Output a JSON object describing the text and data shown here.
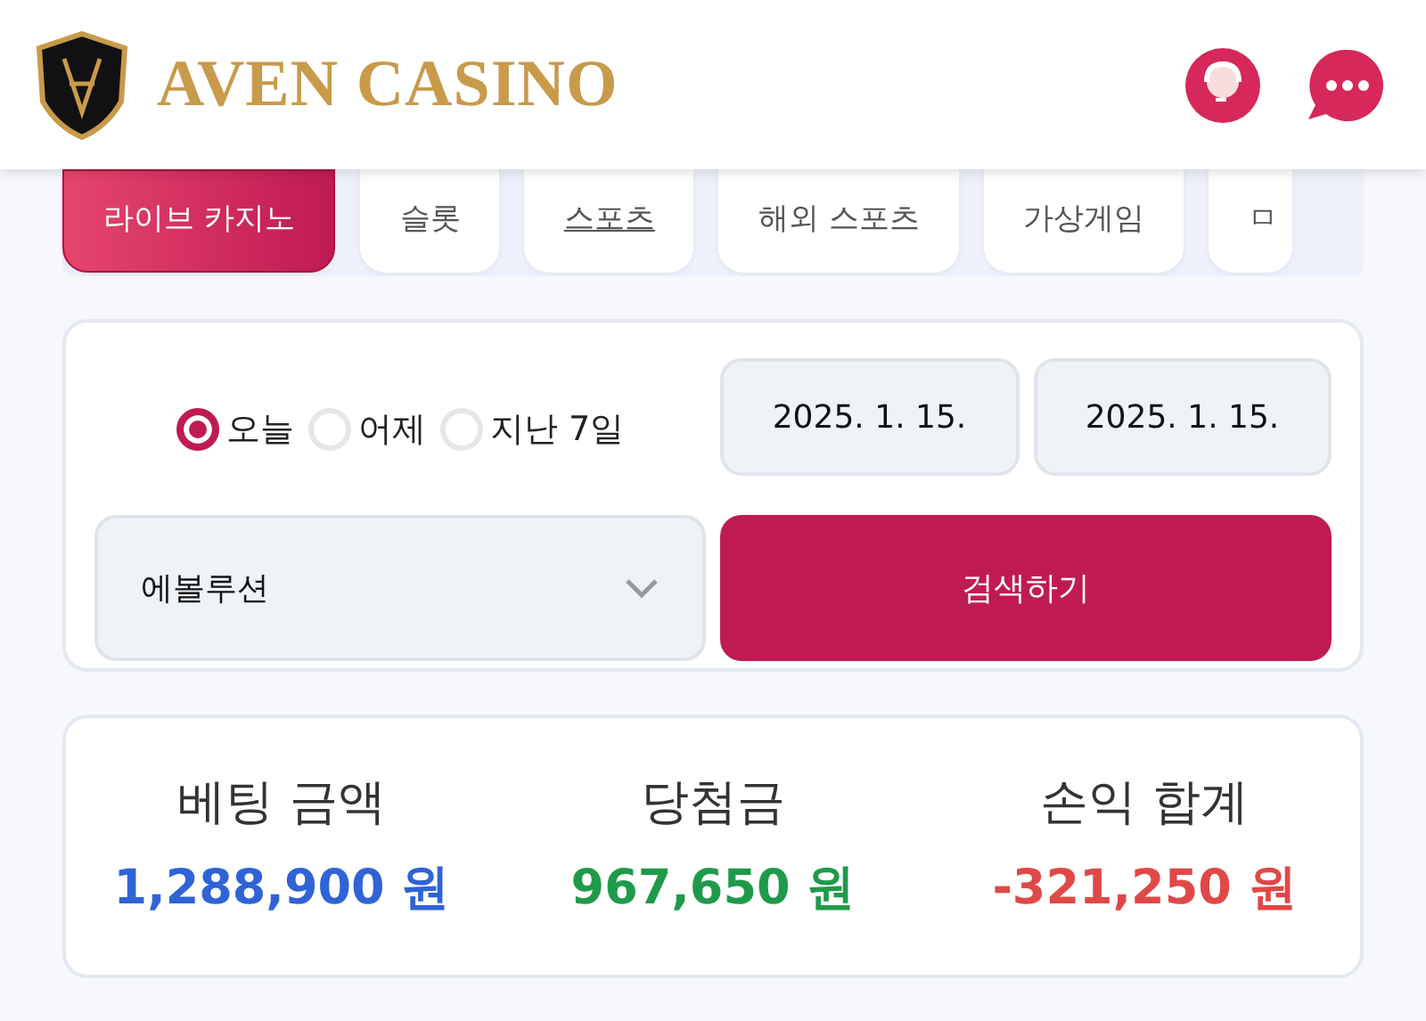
{
  "header": {
    "logo_text": "AVEN CASINO"
  },
  "tabs": [
    {
      "label": "라이브 카지노",
      "selected": true,
      "underlined": false
    },
    {
      "label": "슬롯",
      "selected": false,
      "underlined": false
    },
    {
      "label": "스포츠",
      "selected": false,
      "underlined": true
    },
    {
      "label": "해외 스포츠",
      "selected": false,
      "underlined": false
    },
    {
      "label": "가상게임",
      "selected": false,
      "underlined": false
    },
    {
      "label": "ㅁ",
      "selected": false,
      "underlined": false
    }
  ],
  "filter": {
    "periods": [
      {
        "label": "오늘",
        "selected": true
      },
      {
        "label": "어제",
        "selected": false
      },
      {
        "label": "지난 7일",
        "selected": false
      }
    ],
    "date_from": "2025. 1. 15.",
    "date_to": "2025. 1. 15.",
    "provider": "에볼루션",
    "search_button": "검색하기"
  },
  "summary": [
    {
      "label": "베팅 금액",
      "value": "1,288,900 원",
      "color": "#2f63d6"
    },
    {
      "label": "당첨금",
      "value": "967,650 원",
      "color": "#1f9a4a"
    },
    {
      "label": "손익 합계",
      "value": "-321,250 원",
      "color": "#e04848"
    }
  ]
}
